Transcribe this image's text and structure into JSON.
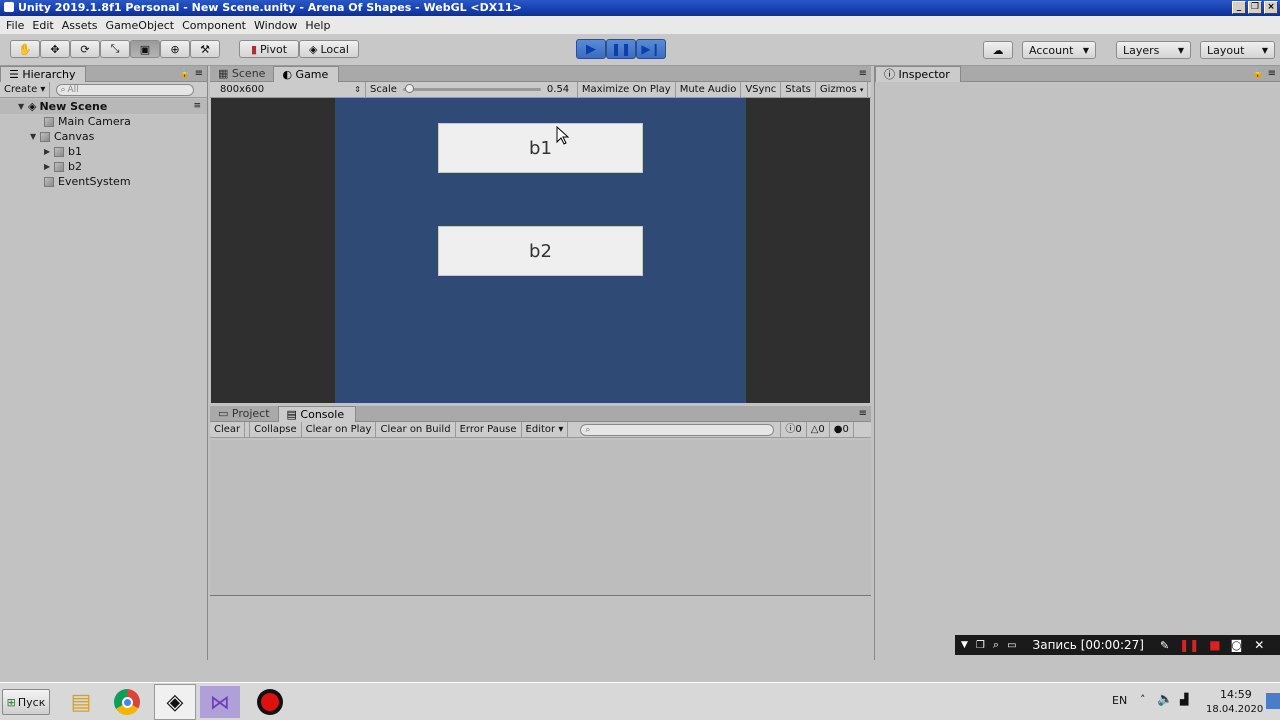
{
  "window": {
    "title": "Unity 2019.1.8f1 Personal - New Scene.unity - Arena Of Shapes - WebGL <DX11>",
    "min": "_",
    "restore": "❐",
    "close": "×"
  },
  "menu": [
    "File",
    "Edit",
    "Assets",
    "GameObject",
    "Component",
    "Window",
    "Help"
  ],
  "toolbar": {
    "pivot": "Pivot",
    "local": "Local",
    "account": "Account",
    "layers": "Layers",
    "layout": "Layout"
  },
  "hierarchy": {
    "tab": "Hierarchy",
    "create": "Create",
    "search_placeholder": "All",
    "scene": "New Scene",
    "items": [
      "Main Camera",
      "Canvas",
      "b1",
      "b2",
      "EventSystem"
    ]
  },
  "scene_tabs": {
    "scene": "Scene",
    "game": "Game"
  },
  "game_bar": {
    "resolution": "800x600",
    "scale_label": "Scale",
    "scale_value": "0.54",
    "scale_fraction": 0.02,
    "maximize": "Maximize On Play",
    "mute": "Mute Audio",
    "vsync": "VSync",
    "stats": "Stats",
    "gizmos": "Gizmos"
  },
  "game_view": {
    "bg_color": "#2f4a74",
    "buttons": [
      "b1",
      "b2"
    ]
  },
  "bottom_tabs": {
    "project": "Project",
    "console": "Console"
  },
  "console_bar": {
    "clear": "Clear",
    "collapse": "Collapse",
    "clear_on_play": "Clear on Play",
    "clear_on_build": "Clear on Build",
    "error_pause": "Error Pause",
    "editor": "Editor",
    "info_count": "0",
    "warn_count": "0",
    "error_count": "0"
  },
  "inspector": {
    "tab": "Inspector"
  },
  "recorder": {
    "label": "Запись [00:00:27]"
  },
  "taskbar": {
    "start": "Пуск",
    "lang": "EN",
    "time": "14:59",
    "date": "18.04.2020"
  }
}
